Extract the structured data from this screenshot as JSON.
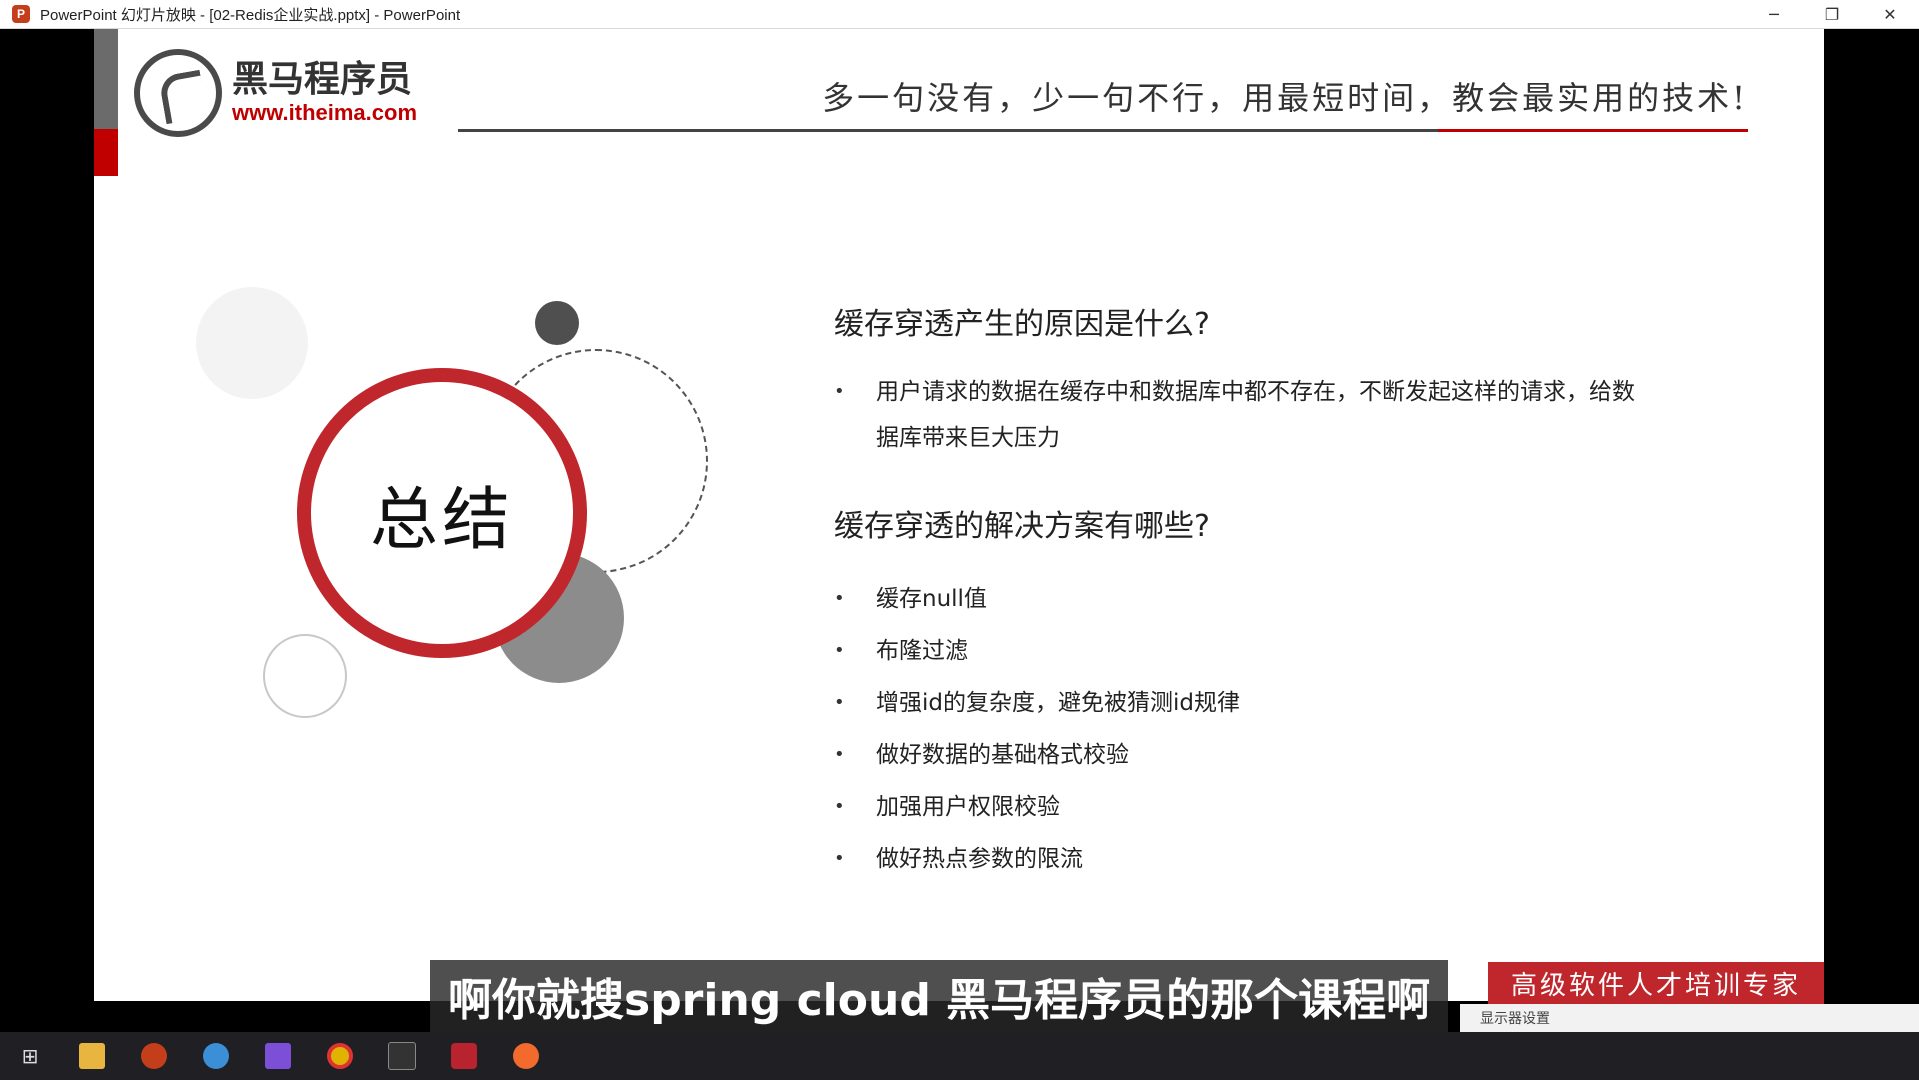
{
  "window": {
    "app_icon_glyph": "P",
    "title": "PowerPoint 幻灯片放映 - [02-Redis企业实战.pptx] - PowerPoint",
    "minimize_glyph": "─",
    "restore_glyph": "❐",
    "close_glyph": "✕"
  },
  "slide": {
    "logo": {
      "brand_cn": "黑马程序员",
      "brand_url": "www.itheima.com"
    },
    "slogan": "多一句没有，少一句不行，用最短时间，教会最实用的技术!",
    "summary_title": "总结",
    "sections": [
      {
        "heading": "缓存穿透产生的原因是什么?",
        "bullets": [
          "用户请求的数据在缓存中和数据库中都不存在，不断发起这样的请求，给数据库带来巨大压力"
        ]
      },
      {
        "heading": "缓存穿透的解决方案有哪些?",
        "bullets": [
          "缓存null值",
          "布隆过滤",
          "增强id的复杂度，避免被猜测id规律",
          "做好数据的基础格式校验",
          "加强用户权限校验",
          "做好热点参数的限流"
        ]
      }
    ],
    "red_banner": "高级软件人才培训专家"
  },
  "overlay": {
    "subtitle": "啊你就搜spring cloud 黑马程序员的那个课程啊"
  },
  "status_strip": {
    "display_settings": "显示器设置"
  },
  "taskbar": {
    "icons": [
      "windows-start-icon",
      "file-explorer-icon",
      "powerpoint-icon",
      "browser-icon",
      "ide-icon",
      "chrome-icon",
      "terminal-icon",
      "redis-icon",
      "paint-icon"
    ]
  },
  "colors": {
    "accent_red": "#c0272d",
    "brand_red": "#c00000",
    "dark_gray": "#4a4a4a"
  }
}
